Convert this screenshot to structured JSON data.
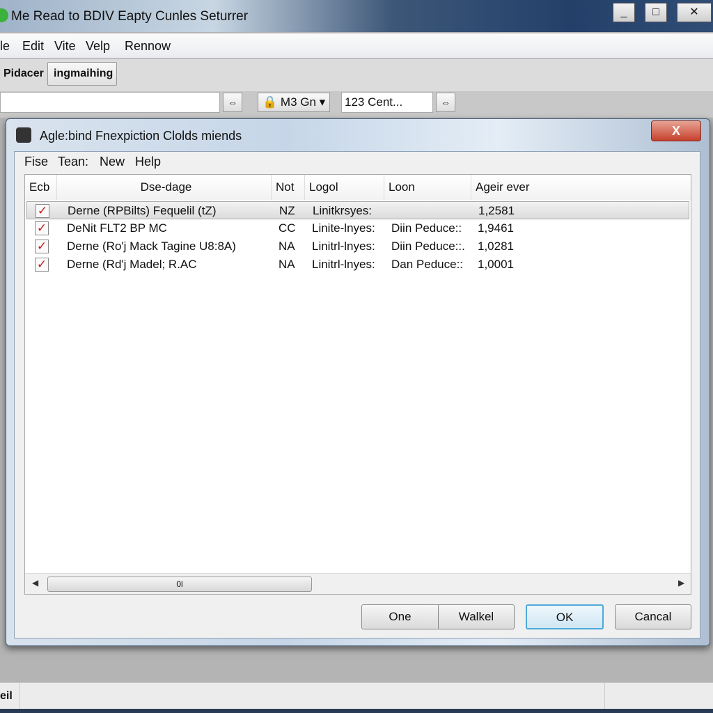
{
  "window": {
    "title": "Me Read to BDIV Eapty Cunles Seturrer",
    "controls": [
      "_",
      "□",
      "✕"
    ]
  },
  "menu": [
    "le",
    "Edit",
    "Vite",
    "Velp",
    "Rennow"
  ],
  "toolbar": {
    "tabs": [
      "Pidacer",
      "ingmaihing"
    ]
  },
  "address": {
    "swap_icon": "⇔",
    "dropdown_label": "M3 Gn",
    "field_value": "123 Cent..."
  },
  "dialog": {
    "title": "Agle:bind Fnexpiction Clolds miends",
    "close_label": "X",
    "menu": [
      "Fise",
      "Tean:",
      "New",
      "Help"
    ],
    "columns": [
      "Ecb",
      "Dse-dage",
      "Not",
      "Logol",
      "Loon",
      "Ageir ever"
    ],
    "rows": [
      {
        "checked": true,
        "desc": "Derne (RPBilts) Fequelil (tZ)",
        "not": "NZ",
        "logol": "Linitkrsyes:",
        "loon": "",
        "value": "1,2581",
        "selected": true
      },
      {
        "checked": true,
        "desc": "DeNit FLT2 BP MC",
        "not": "CC",
        "logol": "Linite-lnyes:",
        "loon": "Diin Peduce::",
        "value": "1,9461",
        "selected": false
      },
      {
        "checked": true,
        "desc": "Derne (Ro'j Mack Tagine U8:8A)",
        "not": "NA",
        "logol": "Linitrl-lnyes:",
        "loon": "Diin Peduce::.",
        "value": "1,0281",
        "selected": false
      },
      {
        "checked": true,
        "desc": "Derne (Rd'j Madel; R.AC",
        "not": "NA",
        "logol": "Linitrl-lnyes:",
        "loon": "Dan Peduce::",
        "value": "1,0001",
        "selected": false
      }
    ],
    "scroll_thumb_label": "0l",
    "buttons": {
      "one": "One",
      "walkel": "Walkel",
      "ok": "OK",
      "cancel": "Cancal"
    }
  },
  "status": {
    "left": "eil"
  }
}
